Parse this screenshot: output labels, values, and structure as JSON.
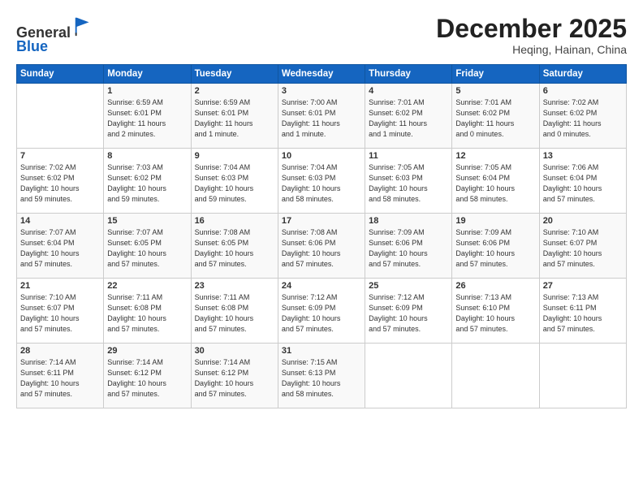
{
  "header": {
    "logo_line1": "General",
    "logo_line2": "Blue",
    "month_title": "December 2025",
    "location": "Heqing, Hainan, China"
  },
  "days_of_week": [
    "Sunday",
    "Monday",
    "Tuesday",
    "Wednesday",
    "Thursday",
    "Friday",
    "Saturday"
  ],
  "weeks": [
    [
      {
        "day": "",
        "info": ""
      },
      {
        "day": "1",
        "info": "Sunrise: 6:59 AM\nSunset: 6:01 PM\nDaylight: 11 hours\nand 2 minutes."
      },
      {
        "day": "2",
        "info": "Sunrise: 6:59 AM\nSunset: 6:01 PM\nDaylight: 11 hours\nand 1 minute."
      },
      {
        "day": "3",
        "info": "Sunrise: 7:00 AM\nSunset: 6:01 PM\nDaylight: 11 hours\nand 1 minute."
      },
      {
        "day": "4",
        "info": "Sunrise: 7:01 AM\nSunset: 6:02 PM\nDaylight: 11 hours\nand 1 minute."
      },
      {
        "day": "5",
        "info": "Sunrise: 7:01 AM\nSunset: 6:02 PM\nDaylight: 11 hours\nand 0 minutes."
      },
      {
        "day": "6",
        "info": "Sunrise: 7:02 AM\nSunset: 6:02 PM\nDaylight: 11 hours\nand 0 minutes."
      }
    ],
    [
      {
        "day": "7",
        "info": "Sunrise: 7:02 AM\nSunset: 6:02 PM\nDaylight: 10 hours\nand 59 minutes."
      },
      {
        "day": "8",
        "info": "Sunrise: 7:03 AM\nSunset: 6:02 PM\nDaylight: 10 hours\nand 59 minutes."
      },
      {
        "day": "9",
        "info": "Sunrise: 7:04 AM\nSunset: 6:03 PM\nDaylight: 10 hours\nand 59 minutes."
      },
      {
        "day": "10",
        "info": "Sunrise: 7:04 AM\nSunset: 6:03 PM\nDaylight: 10 hours\nand 58 minutes."
      },
      {
        "day": "11",
        "info": "Sunrise: 7:05 AM\nSunset: 6:03 PM\nDaylight: 10 hours\nand 58 minutes."
      },
      {
        "day": "12",
        "info": "Sunrise: 7:05 AM\nSunset: 6:04 PM\nDaylight: 10 hours\nand 58 minutes."
      },
      {
        "day": "13",
        "info": "Sunrise: 7:06 AM\nSunset: 6:04 PM\nDaylight: 10 hours\nand 57 minutes."
      }
    ],
    [
      {
        "day": "14",
        "info": "Sunrise: 7:07 AM\nSunset: 6:04 PM\nDaylight: 10 hours\nand 57 minutes."
      },
      {
        "day": "15",
        "info": "Sunrise: 7:07 AM\nSunset: 6:05 PM\nDaylight: 10 hours\nand 57 minutes."
      },
      {
        "day": "16",
        "info": "Sunrise: 7:08 AM\nSunset: 6:05 PM\nDaylight: 10 hours\nand 57 minutes."
      },
      {
        "day": "17",
        "info": "Sunrise: 7:08 AM\nSunset: 6:06 PM\nDaylight: 10 hours\nand 57 minutes."
      },
      {
        "day": "18",
        "info": "Sunrise: 7:09 AM\nSunset: 6:06 PM\nDaylight: 10 hours\nand 57 minutes."
      },
      {
        "day": "19",
        "info": "Sunrise: 7:09 AM\nSunset: 6:06 PM\nDaylight: 10 hours\nand 57 minutes."
      },
      {
        "day": "20",
        "info": "Sunrise: 7:10 AM\nSunset: 6:07 PM\nDaylight: 10 hours\nand 57 minutes."
      }
    ],
    [
      {
        "day": "21",
        "info": "Sunrise: 7:10 AM\nSunset: 6:07 PM\nDaylight: 10 hours\nand 57 minutes."
      },
      {
        "day": "22",
        "info": "Sunrise: 7:11 AM\nSunset: 6:08 PM\nDaylight: 10 hours\nand 57 minutes."
      },
      {
        "day": "23",
        "info": "Sunrise: 7:11 AM\nSunset: 6:08 PM\nDaylight: 10 hours\nand 57 minutes."
      },
      {
        "day": "24",
        "info": "Sunrise: 7:12 AM\nSunset: 6:09 PM\nDaylight: 10 hours\nand 57 minutes."
      },
      {
        "day": "25",
        "info": "Sunrise: 7:12 AM\nSunset: 6:09 PM\nDaylight: 10 hours\nand 57 minutes."
      },
      {
        "day": "26",
        "info": "Sunrise: 7:13 AM\nSunset: 6:10 PM\nDaylight: 10 hours\nand 57 minutes."
      },
      {
        "day": "27",
        "info": "Sunrise: 7:13 AM\nSunset: 6:11 PM\nDaylight: 10 hours\nand 57 minutes."
      }
    ],
    [
      {
        "day": "28",
        "info": "Sunrise: 7:14 AM\nSunset: 6:11 PM\nDaylight: 10 hours\nand 57 minutes."
      },
      {
        "day": "29",
        "info": "Sunrise: 7:14 AM\nSunset: 6:12 PM\nDaylight: 10 hours\nand 57 minutes."
      },
      {
        "day": "30",
        "info": "Sunrise: 7:14 AM\nSunset: 6:12 PM\nDaylight: 10 hours\nand 57 minutes."
      },
      {
        "day": "31",
        "info": "Sunrise: 7:15 AM\nSunset: 6:13 PM\nDaylight: 10 hours\nand 58 minutes."
      },
      {
        "day": "",
        "info": ""
      },
      {
        "day": "",
        "info": ""
      },
      {
        "day": "",
        "info": ""
      }
    ]
  ]
}
